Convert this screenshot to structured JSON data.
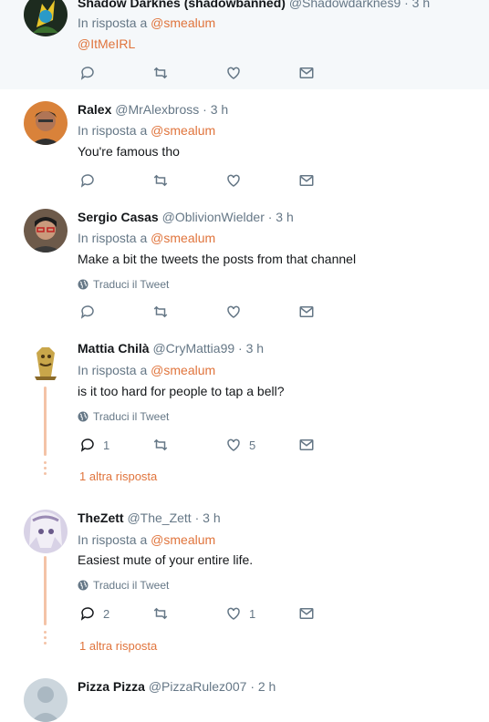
{
  "mention_prefix": "In risposta a",
  "translate_label": "Traduci il Tweet",
  "colors": {
    "accent": "#e0743c",
    "muted": "#657786",
    "border": "#e6ecf0",
    "thread": "#f4c3a7"
  },
  "tweets": [
    {
      "name": "Shadow Darknes (shadowbanned)",
      "handle": "@Shadowdarknes9",
      "time": "· 3 h",
      "reply_to": "@smealum",
      "text": "@ItMeIRL"
    },
    {
      "name": "Ralex",
      "handle": "@MrAlexbross",
      "time": "· 3 h",
      "reply_to": "@smealum",
      "text": "You're famous tho"
    },
    {
      "name": "Sergio Casas",
      "handle": "@OblivionWielder",
      "time": "· 3 h",
      "reply_to": "@smealum",
      "text": "Make a bit the tweets the posts from that channel"
    },
    {
      "name": "Mattia Chilà",
      "handle": "@CryMattia99",
      "time": "· 3 h",
      "reply_to": "@smealum",
      "text": "is it too hard for people to tap a bell?",
      "reply_count": "1",
      "like_count": "5",
      "more_replies": "1 altra risposta"
    },
    {
      "name": "TheZett",
      "handle": "@The_Zett",
      "time": "· 3 h",
      "reply_to": "@smealum",
      "text": "Easiest mute of your entire life.",
      "reply_count": "2",
      "like_count": "1",
      "more_replies": "1 altra risposta"
    },
    {
      "name": "Pizza Pizza",
      "handle": "@PizzaRulez007",
      "time": "· 2 h"
    }
  ]
}
